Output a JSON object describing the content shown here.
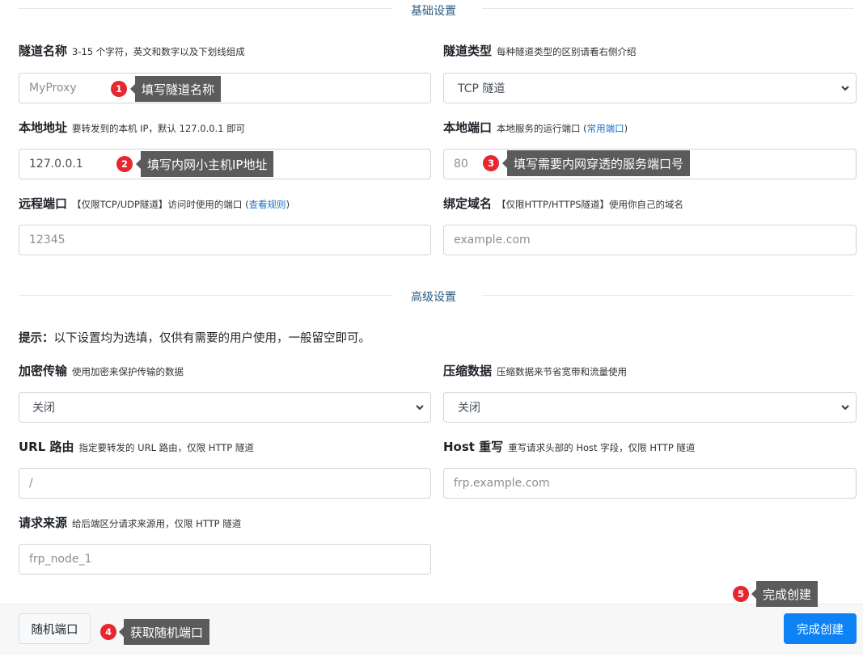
{
  "sections": {
    "basic": "基础设置",
    "advanced": "高级设置"
  },
  "fields": {
    "tunnel_name": {
      "label": "隧道名称",
      "hint": "3-15 个字符，英文和数字以及下划线组成",
      "placeholder": "MyProxy"
    },
    "tunnel_type": {
      "label": "隧道类型",
      "hint": "每种隧道类型的区别请看右侧介绍",
      "value": "TCP 隧道"
    },
    "local_address": {
      "label": "本地地址",
      "hint": "要转发到的本机 IP，默认 127.0.0.1 即可",
      "placeholder": "127.0.0.1"
    },
    "local_port": {
      "label": "本地端口",
      "hint_before": "本地服务的运行端口 (",
      "hint_link": "常用端口",
      "hint_after": ")",
      "placeholder": "80"
    },
    "remote_port": {
      "label": "远程端口",
      "hint_before": "【仅限TCP/UDP隧道】访问时使用的端口 (",
      "hint_link": "查看规则",
      "hint_after": ")",
      "placeholder": "12345"
    },
    "bind_domain": {
      "label": "绑定域名",
      "hint": "【仅限HTTP/HTTPS隧道】使用你自己的域名",
      "placeholder": "example.com"
    },
    "encryption": {
      "label": "加密传输",
      "hint": "使用加密来保护传输的数据",
      "value": "关闭"
    },
    "compression": {
      "label": "压缩数据",
      "hint": "压缩数据来节省宽带和流量使用",
      "value": "关闭"
    },
    "url_route": {
      "label": "URL 路由",
      "hint": "指定要转发的 URL 路由，仅限 HTTP 隧道",
      "placeholder": "/"
    },
    "host_rewrite": {
      "label": "Host 重写",
      "hint": "重写请求头部的 Host 字段，仅限 HTTP 隧道",
      "placeholder": "frp.example.com"
    },
    "request_source": {
      "label": "请求来源",
      "hint": "给后端区分请求来源用，仅限 HTTP 隧道",
      "placeholder": "frp_node_1"
    }
  },
  "tip": {
    "prefix": "提示：",
    "text": "以下设置均为选填，仅供有需要的用户使用，一般留空即可。"
  },
  "footer": {
    "random_port": "随机端口",
    "submit": "完成创建"
  },
  "annotations": [
    {
      "num": "1",
      "text": "填写隧道名称"
    },
    {
      "num": "2",
      "text": "填写内网小主机IP地址"
    },
    {
      "num": "3",
      "text": "填写需要内网穿透的服务端口号"
    },
    {
      "num": "4",
      "text": "获取随机端口"
    },
    {
      "num": "5",
      "text": "完成创建"
    }
  ],
  "colors": {
    "accent": "#0d82f5",
    "badge": "#e8262f",
    "callout": "#5b5b5b"
  }
}
